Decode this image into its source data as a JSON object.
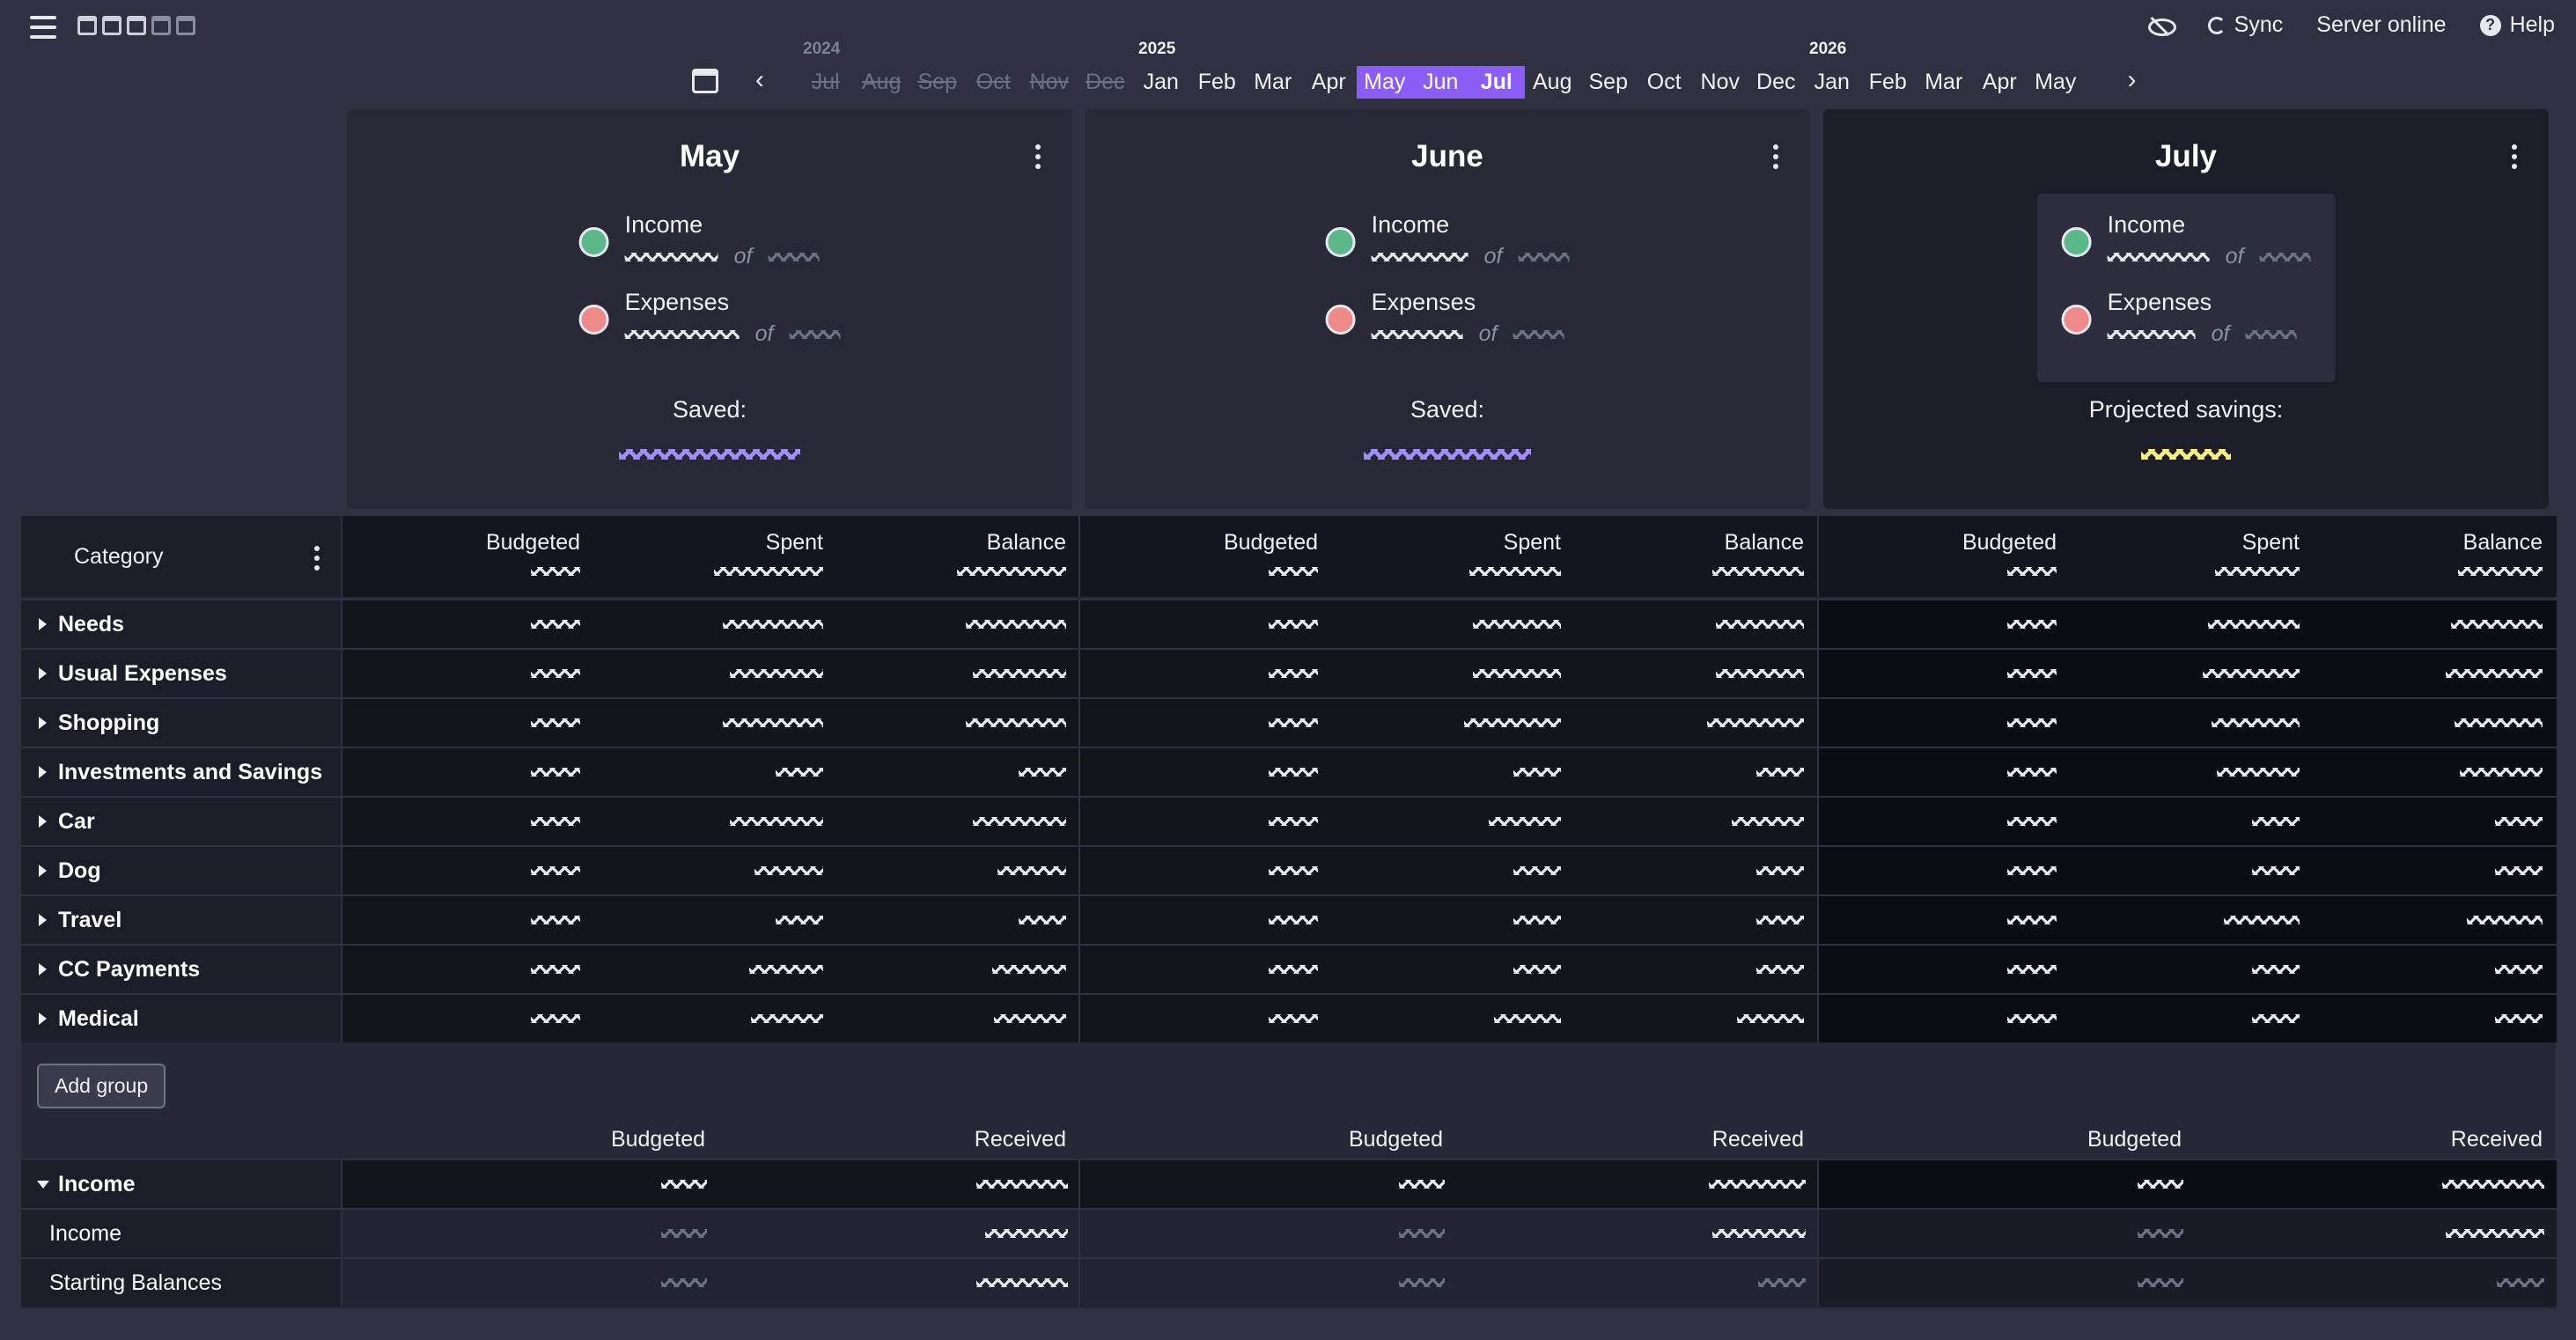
{
  "topbar": {
    "sync": "Sync",
    "server": "Server online",
    "help": "Help"
  },
  "years": [
    "2024",
    "2025",
    "2026"
  ],
  "months": [
    "Jul",
    "Aug",
    "Sep",
    "Oct",
    "Nov",
    "Dec",
    "Jan",
    "Feb",
    "Mar",
    "Apr",
    "May",
    "Jun",
    "Jul",
    "Aug",
    "Sep",
    "Oct",
    "Nov",
    "Dec",
    "Jan",
    "Feb",
    "Mar",
    "Apr",
    "May"
  ],
  "summary": [
    {
      "title": "May",
      "income": "Income",
      "expenses": "Expenses",
      "of": "of",
      "saved": "Saved:"
    },
    {
      "title": "June",
      "income": "Income",
      "expenses": "Expenses",
      "of": "of",
      "saved": "Saved:"
    },
    {
      "title": "July",
      "income": "Income",
      "expenses": "Expenses",
      "of": "of",
      "saved": "Projected savings:"
    }
  ],
  "table": {
    "category_header": "Category",
    "columns": [
      "Budgeted",
      "Spent",
      "Balance"
    ],
    "groups": [
      "Needs",
      "Usual Expenses",
      "Shopping",
      "Investments and Savings",
      "Car",
      "Dog",
      "Travel",
      "CC Payments",
      "Medical"
    ],
    "add_group": "Add group",
    "income_columns": [
      "Budgeted",
      "Received"
    ],
    "income_group": "Income",
    "income_rows": [
      "Income",
      "Starting Balances"
    ]
  },
  "colors": {
    "accent": "#8b5cf6",
    "income_dot": "#5ab88a",
    "expense_dot": "#f08a8a",
    "saved": "#a78bfa",
    "projected": "#f5f07a"
  }
}
